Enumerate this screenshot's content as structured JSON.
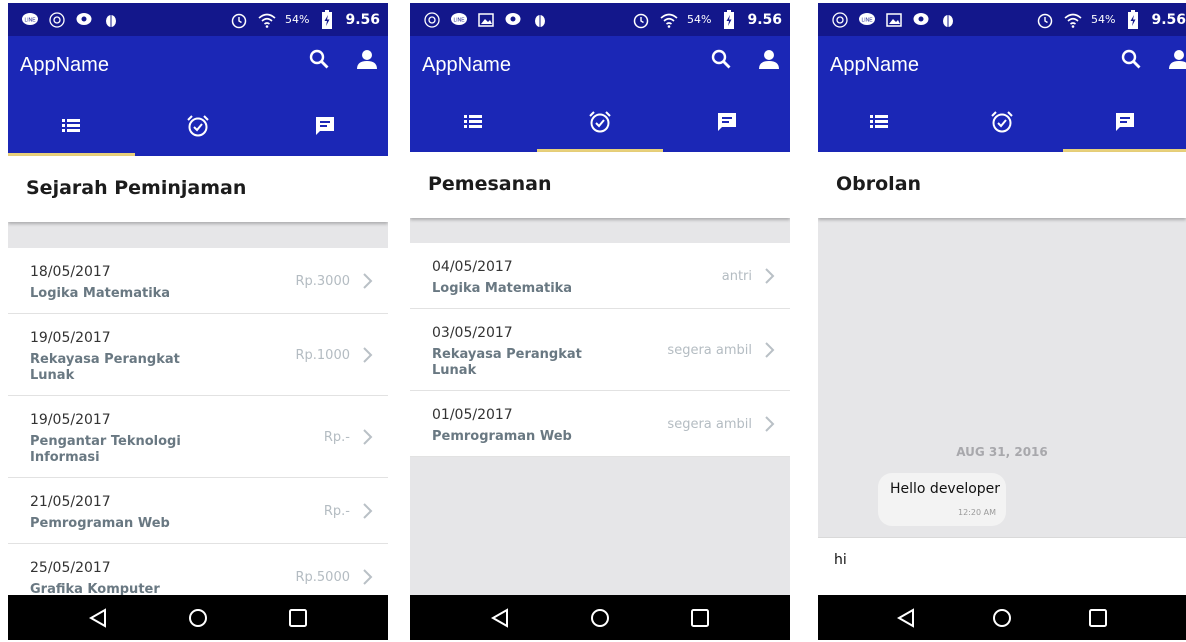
{
  "status_bar": {
    "battery": "54%",
    "time": "9.56"
  },
  "app": {
    "title": "AppName"
  },
  "screens": {
    "history": {
      "title": "Sejarah Peminjaman",
      "items": [
        {
          "date": "18/05/2017",
          "title": "Logika Matematika",
          "value": "Rp.3000"
        },
        {
          "date": "19/05/2017",
          "title": "Rekayasa Perangkat Lunak",
          "value": "Rp.1000"
        },
        {
          "date": "19/05/2017",
          "title": "Pengantar Teknologi Informasi",
          "value": "Rp.-"
        },
        {
          "date": "21/05/2017",
          "title": "Pemrograman Web",
          "value": "Rp.-"
        },
        {
          "date": "25/05/2017",
          "title": "Grafika Komputer",
          "value": "Rp.5000"
        }
      ]
    },
    "orders": {
      "title": "Pemesanan",
      "items": [
        {
          "date": "04/05/2017",
          "title": "Logika Matematika",
          "status": "antri"
        },
        {
          "date": "03/05/2017",
          "title": "Rekayasa Perangkat Lunak",
          "status": "segera ambil"
        },
        {
          "date": "01/05/2017",
          "title": "Pemrograman Web",
          "status": "segera ambil"
        }
      ]
    },
    "chat": {
      "title": "Obrolan",
      "date_label": "AUG 31, 2016",
      "message": {
        "text": "Hello developer",
        "time": "12:20 AM"
      },
      "input_value": "hi"
    }
  },
  "colors": {
    "statusbar": "#13178b",
    "appbar": "#1b27b6",
    "tab_indicator": "#e8d07a",
    "background": "#e6e6e8"
  },
  "icons": {
    "tabs": [
      "list-icon",
      "alarm-icon",
      "chat-icon"
    ],
    "actions": [
      "search-icon",
      "account-icon"
    ],
    "nav": [
      "back-icon",
      "home-icon",
      "recents-icon"
    ]
  }
}
